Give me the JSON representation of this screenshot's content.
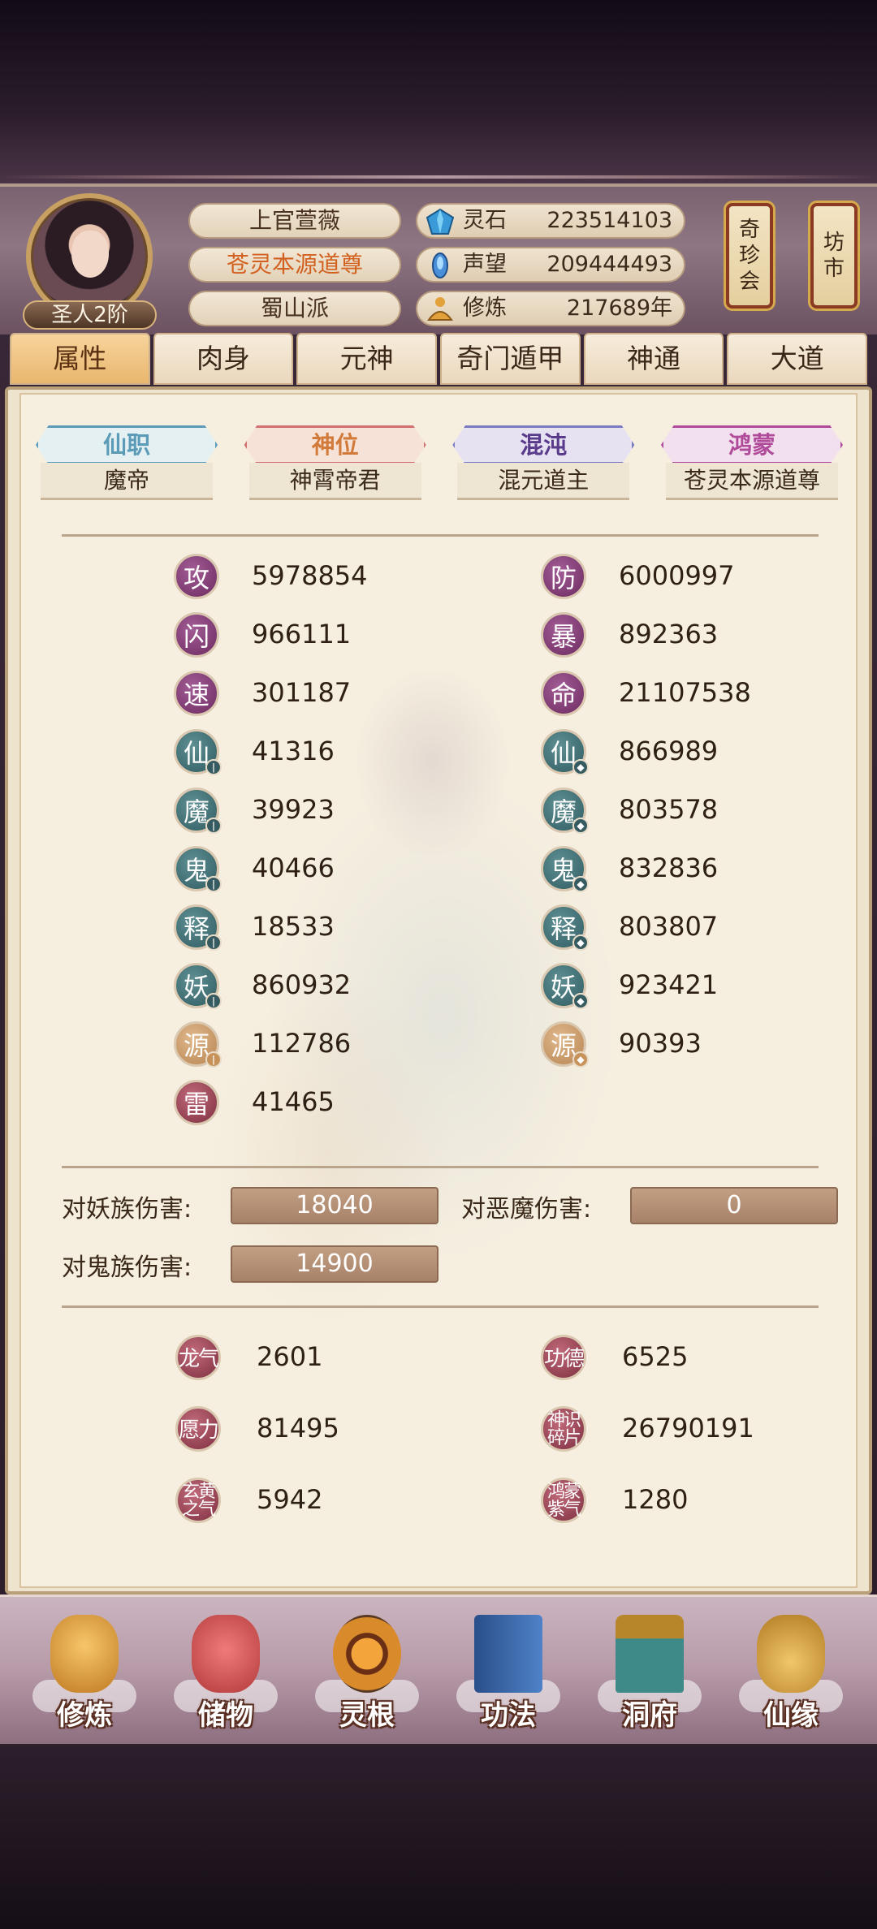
{
  "player": {
    "rank": "圣人2阶",
    "name": "上官萱薇",
    "title": "苍灵本源道尊",
    "sect": "蜀山派"
  },
  "resources": [
    {
      "label": "灵石",
      "value": "223514103",
      "icon": "spirit-stone-icon"
    },
    {
      "label": "声望",
      "value": "209444493",
      "icon": "prestige-icon"
    },
    {
      "label": "修炼",
      "value": "217689年",
      "icon": "cultivation-icon"
    }
  ],
  "side_buttons": {
    "treasure": "奇珍会",
    "market": "坊市"
  },
  "tabs": [
    "属性",
    "肉身",
    "元神",
    "奇门遁甲",
    "神通",
    "大道"
  ],
  "active_tab": "属性",
  "ranks": [
    {
      "title": "仙职",
      "value": "魔帝",
      "color": "#5b9bb8"
    },
    {
      "title": "神位",
      "value": "神霄帝君",
      "color": "#d27a3a"
    },
    {
      "title": "混沌",
      "value": "混元道主",
      "color": "#6a4a9a"
    },
    {
      "title": "鸿蒙",
      "value": "苍灵本源道尊",
      "color": "#b04a9a"
    }
  ],
  "stats_left": [
    {
      "glyph": "攻",
      "value": "5978854"
    },
    {
      "glyph": "闪",
      "value": "966111"
    },
    {
      "glyph": "速",
      "value": "301187"
    },
    {
      "glyph": "仙",
      "value": "41316"
    },
    {
      "glyph": "魔",
      "value": "39923"
    },
    {
      "glyph": "鬼",
      "value": "40466"
    },
    {
      "glyph": "释",
      "value": "18533"
    },
    {
      "glyph": "妖",
      "value": "860932"
    },
    {
      "glyph": "源",
      "value": "112786"
    },
    {
      "glyph": "雷",
      "value": "41465"
    }
  ],
  "stats_right": [
    {
      "glyph": "防",
      "value": "6000997"
    },
    {
      "glyph": "暴",
      "value": "892363"
    },
    {
      "glyph": "命",
      "value": "21107538"
    },
    {
      "glyph": "仙",
      "value": "866989"
    },
    {
      "glyph": "魔",
      "value": "803578"
    },
    {
      "glyph": "鬼",
      "value": "832836"
    },
    {
      "glyph": "释",
      "value": "803807"
    },
    {
      "glyph": "妖",
      "value": "923421"
    },
    {
      "glyph": "源",
      "value": "90393"
    }
  ],
  "damage": {
    "demon_beast_label": "对妖族伤害:",
    "demon_beast_value": "18040",
    "evil_demon_label": "对恶魔伤害:",
    "evil_demon_value": "0",
    "ghost_label": "对鬼族伤害:",
    "ghost_value": "14900"
  },
  "misc": [
    {
      "glyph": "龙气",
      "value": "2601"
    },
    {
      "glyph": "功德",
      "value": "6525"
    },
    {
      "glyph": "愿力",
      "value": "81495"
    },
    {
      "glyph": "神识碎片",
      "value": "26790191"
    },
    {
      "glyph": "玄黄之气",
      "value": "5942"
    },
    {
      "glyph": "鸿蒙紫气",
      "value": "1280"
    }
  ],
  "bottom_nav": [
    {
      "label": "修炼",
      "icon": "meditating-monk-icon"
    },
    {
      "label": "储物",
      "icon": "storage-bag-icon"
    },
    {
      "label": "灵根",
      "icon": "spirit-root-icon"
    },
    {
      "label": "功法",
      "icon": "technique-book-icon"
    },
    {
      "label": "洞府",
      "icon": "cave-dwelling-icon"
    },
    {
      "label": "仙缘",
      "icon": "fortune-gourd-icon"
    }
  ]
}
